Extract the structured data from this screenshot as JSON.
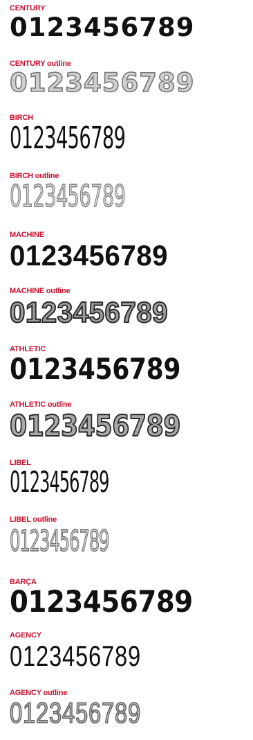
{
  "accent_color": "#c8102e",
  "samples": [
    {
      "name": "CENTURY",
      "digits": "0123456789"
    },
    {
      "name": "CENTURY outline",
      "digits": "0123456789"
    },
    {
      "name": "BIRCH",
      "digits": "0123456789"
    },
    {
      "name": "BIRCH outline",
      "digits": "0123456789"
    },
    {
      "name": "MACHINE",
      "digits": "0123456789"
    },
    {
      "name": "MACHINE outline",
      "digits": "0123456789"
    },
    {
      "name": "ATHLETIC",
      "digits": "0123456789"
    },
    {
      "name": "ATHLETIC outline",
      "digits": "0123456789"
    },
    {
      "name": "LIBEL",
      "digits": "0123456789"
    },
    {
      "name": "LIBEL outline",
      "digits": "0123456789"
    },
    {
      "name": "BARÇA",
      "digits": "0123456789"
    },
    {
      "name": "AGENCY",
      "digits": "0123456789"
    },
    {
      "name": "AGENCY outline",
      "digits": "0123456789"
    }
  ]
}
